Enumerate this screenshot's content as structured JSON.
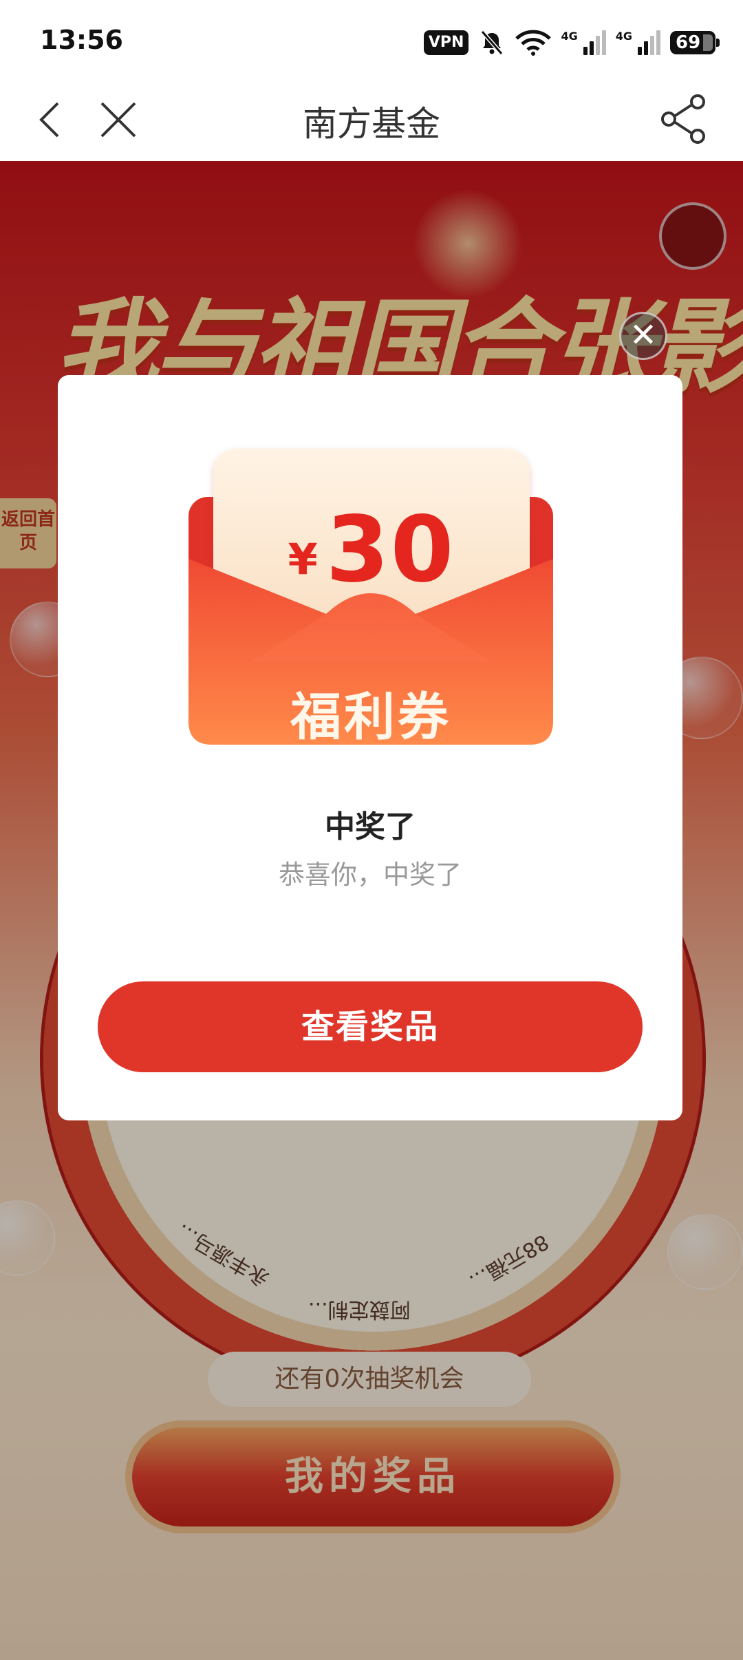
{
  "status_bar": {
    "time": "13:56",
    "vpn_label": "VPN",
    "network_1": "4G",
    "network_2": "4G",
    "battery": "69"
  },
  "nav": {
    "title": "南方基金"
  },
  "background": {
    "banner_title": "我与祖国合张影",
    "home_tab": "返回首页",
    "wheel_segments": [
      "永丰源马...",
      "阿鼓定制...",
      "88元福..."
    ],
    "chances_text": "还有0次抽奖机会",
    "my_prizes_label": "我的奖品"
  },
  "popup": {
    "close_glyph": "✕",
    "coupon": {
      "currency": "¥",
      "amount": "30",
      "label": "福利券"
    },
    "title": "中奖了",
    "subtitle": "恭喜你，中奖了",
    "button_label": "查看奖品"
  },
  "colors": {
    "accent_red": "#e03529",
    "coupon_red": "#e4261e"
  }
}
